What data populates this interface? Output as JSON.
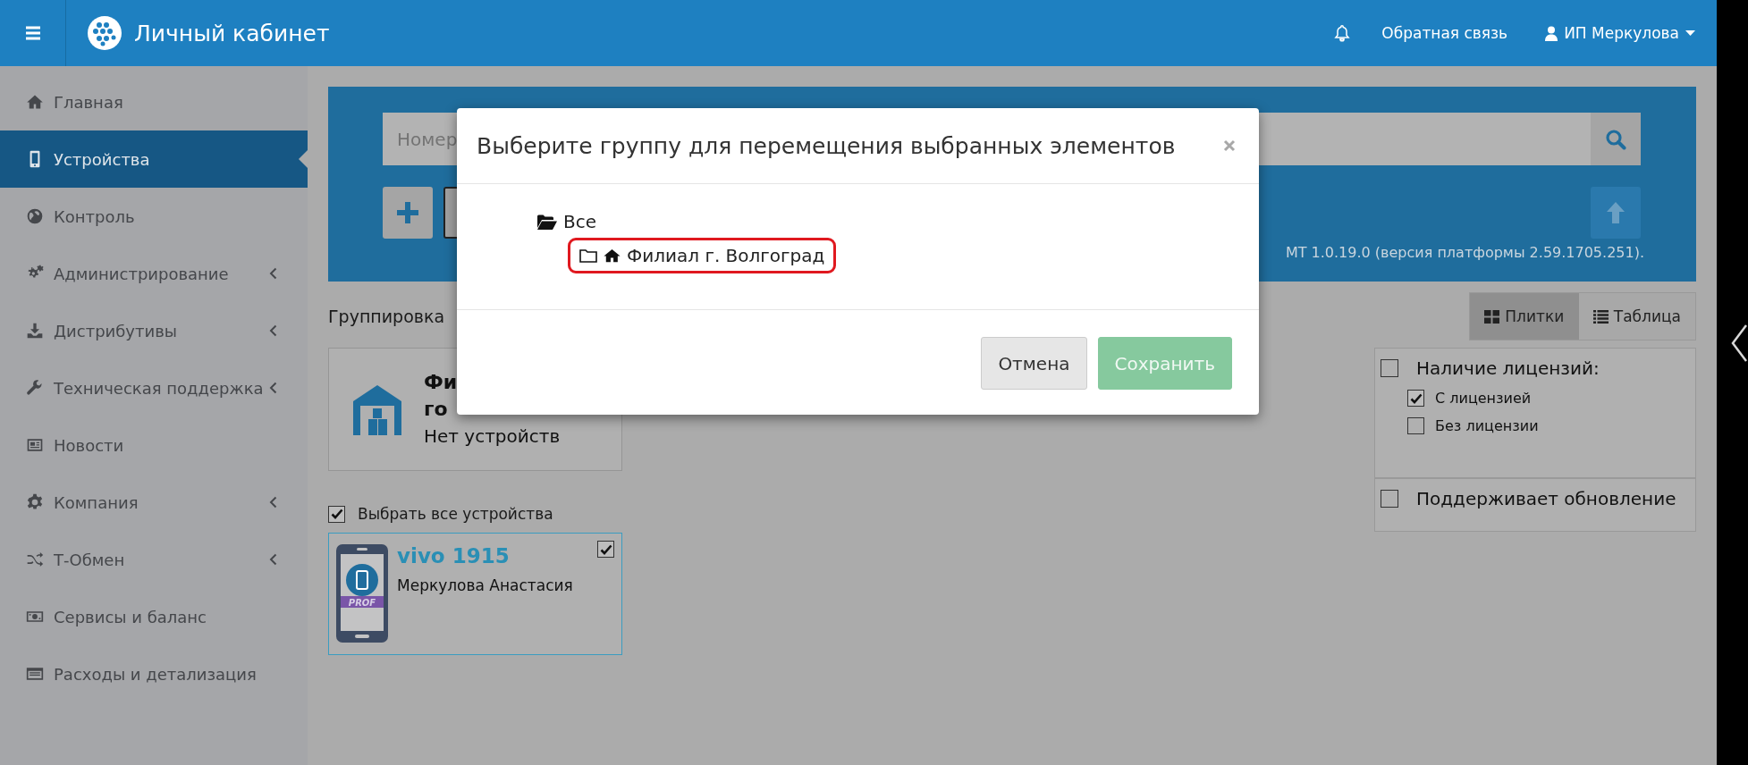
{
  "topbar": {
    "title": "Личный кабинет",
    "feedback": "Обратная связь",
    "user": "ИП Меркулова"
  },
  "sidebar": {
    "items": [
      {
        "label": "Главная",
        "selected": false,
        "has_submenu": false
      },
      {
        "label": "Устройства",
        "selected": true,
        "has_submenu": false
      },
      {
        "label": "Контроль",
        "selected": false,
        "has_submenu": false
      },
      {
        "label": "Администрирование",
        "selected": false,
        "has_submenu": true
      },
      {
        "label": "Дистрибутивы",
        "selected": false,
        "has_submenu": true
      },
      {
        "label": "Техническая поддержка",
        "selected": false,
        "has_submenu": true
      },
      {
        "label": "Новости",
        "selected": false,
        "has_submenu": false
      },
      {
        "label": "Компания",
        "selected": false,
        "has_submenu": true
      },
      {
        "label": "Т-Обмен",
        "selected": false,
        "has_submenu": true
      },
      {
        "label": "Сервисы и баланс",
        "selected": false,
        "has_submenu": false
      },
      {
        "label": "Расходы и детализация",
        "selected": false,
        "has_submenu": false
      }
    ]
  },
  "search": {
    "placeholder": "Номер"
  },
  "version_text": "МТ 1.0.19.0 (версия платформы 2.59.1705.251).",
  "grouping_label": "Группировка",
  "view_toggle": [
    {
      "label": "Плитки",
      "selected": true
    },
    {
      "label": "Таблица",
      "selected": false
    }
  ],
  "groups": [
    {
      "title_lines": [
        "Фи",
        "го"
      ],
      "subtitle": "Нет устройств"
    }
  ],
  "select_all": {
    "label": "Выбрать все устройства",
    "checked": true
  },
  "devices": [
    {
      "name": "vivo 1915",
      "owner": "Меркулова Анастасия",
      "badge": "PROF",
      "checked": true
    }
  ],
  "filters": [
    {
      "label": "Наличие лицензий:",
      "checked": false,
      "options": [
        {
          "label": "С лицензией",
          "checked": true
        },
        {
          "label": "Без лицензии",
          "checked": false
        }
      ]
    },
    {
      "label": "Поддерживает обновление",
      "checked": false
    }
  ],
  "modal": {
    "title": "Выберите группу для перемещения выбранных элементов",
    "tree": [
      {
        "label": "Все",
        "expanded": true,
        "highlighted": false,
        "children": [
          {
            "label": "Филиал г. Волгоград",
            "expanded": false,
            "highlighted": true
          }
        ]
      }
    ],
    "buttons": [
      {
        "label": "Отмена",
        "kind": "default",
        "disabled": false
      },
      {
        "label": "Сохранить",
        "kind": "primary",
        "disabled": true
      }
    ]
  }
}
